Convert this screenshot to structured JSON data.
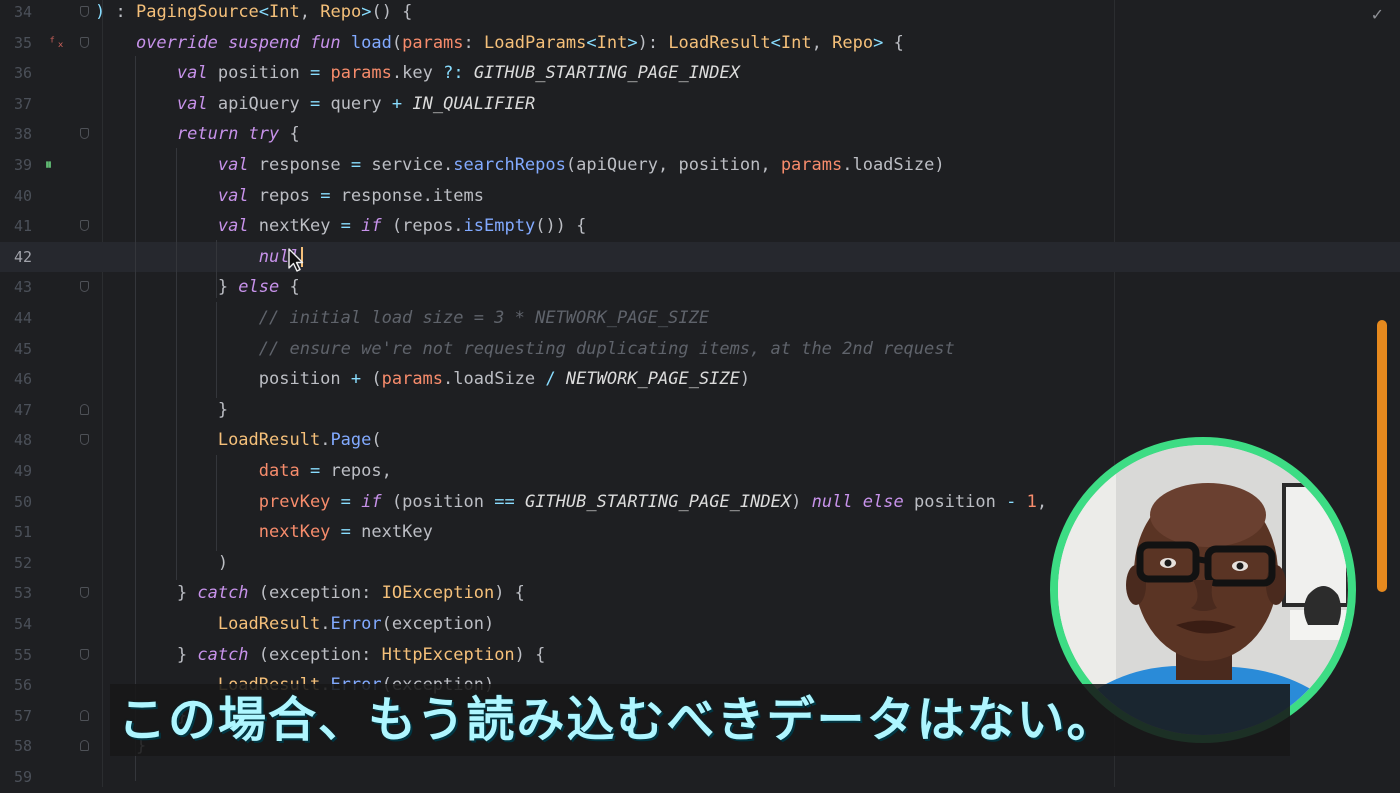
{
  "editor": {
    "status_check": "✓",
    "gutter_icons": {
      "line35": "ᶠₓ",
      "line39": "⏸"
    },
    "lines": [
      {
        "n": "34",
        "html": "<span class=\"op\">)</span> : <span class=\"ty\">PagingSource</span><span class=\"op\">&lt;</span><span class=\"ty\">Int</span>, <span class=\"ty\">Repo</span><span class=\"op\">&gt;</span>() {"
      },
      {
        "n": "35",
        "html": "    <span class=\"kw\">override suspend fun</span> <span class=\"fn\">load</span>(<span class=\"pm\">params</span>: <span class=\"ty\">LoadParams</span><span class=\"op\">&lt;</span><span class=\"ty\">Int</span><span class=\"op\">&gt;</span>): <span class=\"ty\">LoadResult</span><span class=\"op\">&lt;</span><span class=\"ty\">Int</span>, <span class=\"ty\">Repo</span><span class=\"op\">&gt;</span> {"
      },
      {
        "n": "36",
        "html": "        <span class=\"kw\">val</span> position <span class=\"op\">=</span> <span class=\"pm\">params</span>.key <span class=\"op\">?:</span> <span class=\"con\">GITHUB_STARTING_PAGE_INDEX</span>"
      },
      {
        "n": "37",
        "html": "        <span class=\"kw\">val</span> apiQuery <span class=\"op\">=</span> query <span class=\"op\">+</span> <span class=\"con\">IN_QUALIFIER</span>"
      },
      {
        "n": "38",
        "html": "        <span class=\"kw\">return try</span> {"
      },
      {
        "n": "39",
        "html": "            <span class=\"kw\">val</span> response <span class=\"op\">=</span> service.<span class=\"fn\">searchRepos</span>(apiQuery, position, <span class=\"pm\">params</span>.loadSize)"
      },
      {
        "n": "40",
        "html": "            <span class=\"kw\">val</span> repos <span class=\"op\">=</span> response.items"
      },
      {
        "n": "41",
        "html": "            <span class=\"kw\">val</span> nextKey <span class=\"op\">=</span> <span class=\"kw\">if</span> (repos.<span class=\"fn\">isEmpty</span>()) {"
      },
      {
        "n": "42",
        "html": "                <span class=\"nl\">null</span><span class=\"caret\"></span>"
      },
      {
        "n": "43",
        "html": "            } <span class=\"kw\">else</span> {"
      },
      {
        "n": "44",
        "html": "                <span class=\"cm\">// initial load size = 3 * NETWORK_PAGE_SIZE</span>"
      },
      {
        "n": "45",
        "html": "                <span class=\"cm\">// ensure we're not requesting duplicating items, at the 2nd request</span>"
      },
      {
        "n": "46",
        "html": "                position <span class=\"op\">+</span> (<span class=\"pm\">params</span>.loadSize <span class=\"op\">/</span> <span class=\"con\">NETWORK_PAGE_SIZE</span>)"
      },
      {
        "n": "47",
        "html": "            }"
      },
      {
        "n": "48",
        "html": "            <span class=\"ty\">LoadResult</span>.<span class=\"fn\">Page</span>("
      },
      {
        "n": "49",
        "html": "                <span class=\"pm\">data</span> <span class=\"op\">=</span> repos,"
      },
      {
        "n": "50",
        "html": "                <span class=\"pm\">prevKey</span> <span class=\"op\">=</span> <span class=\"kw\">if</span> (position <span class=\"op\">==</span> <span class=\"con\">GITHUB_STARTING_PAGE_INDEX</span>) <span class=\"nl\">null</span> <span class=\"kw\">else</span> position <span class=\"op\">-</span> <span class=\"num\">1</span>,"
      },
      {
        "n": "51",
        "html": "                <span class=\"pm\">nextKey</span> <span class=\"op\">=</span> nextKey"
      },
      {
        "n": "52",
        "html": "            )"
      },
      {
        "n": "53",
        "html": "        } <span class=\"kw\">catch</span> (exception: <span class=\"ty\">IOException</span>) {"
      },
      {
        "n": "54",
        "html": "            <span class=\"ty\">LoadResult</span>.<span class=\"fn\">Error</span>(exception)"
      },
      {
        "n": "55",
        "html": "        } <span class=\"kw\">catch</span> (exception: <span class=\"ty\">HttpException</span>) {"
      },
      {
        "n": "56",
        "html": "            <span class=\"ty\">LoadResult</span>.<span class=\"fn\">Error</span>(exception)"
      },
      {
        "n": "57",
        "html": "        }"
      },
      {
        "n": "58",
        "html": "    }"
      },
      {
        "n": "59",
        "html": ""
      }
    ],
    "current_line": "42"
  },
  "subtitle": {
    "text": "この場合、もう読み込むべきデータはない。"
  },
  "colors": {
    "accent": "#3ddc84",
    "scrollbar": "#e6891e",
    "subtitle": "#aef6ff"
  },
  "webcam": {
    "icon": "presenter-webcam"
  }
}
